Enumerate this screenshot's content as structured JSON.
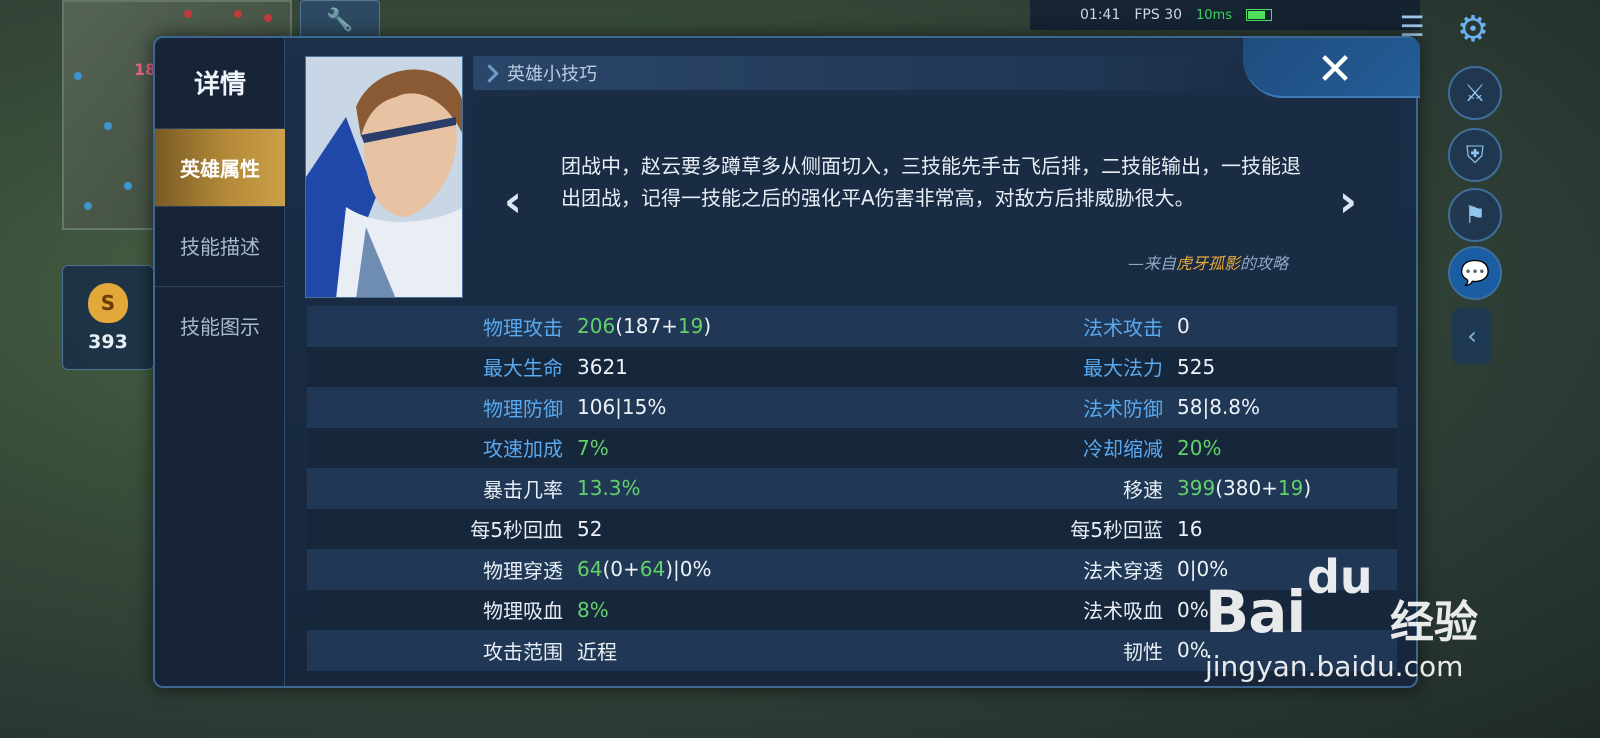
{
  "hud": {
    "minimap_level": "18",
    "gold_value": "393",
    "gold_symbol": "S",
    "timer": "01:41",
    "fps": "FPS 30",
    "net": "10ms"
  },
  "dialog": {
    "title": "详情",
    "tabs": [
      {
        "label": "英雄属性",
        "active": true
      },
      {
        "label": "技能描述",
        "active": false
      },
      {
        "label": "技能图示",
        "active": false
      }
    ],
    "close_glyph": "✕",
    "tips": {
      "header": "英雄小技巧",
      "text": "团战中，赵云要多蹲草多从侧面切入，三技能先手击飞后排，二技能输出，一技能退出团战，记得一技能之后的强化平A伤害非常高，对敌方后排威胁很大。",
      "source_prefix": "—来自",
      "source_author": "虎牙孤影",
      "source_suffix": "的攻略",
      "prev_glyph": "‹",
      "next_glyph": "›"
    },
    "stats": [
      {
        "l1": "物理攻击",
        "l1_color": "blue",
        "v1": [
          {
            "t": "206",
            "c": "green"
          },
          {
            "t": "(187+",
            "c": "white"
          },
          {
            "t": "19",
            "c": "green"
          },
          {
            "t": ")",
            "c": "white"
          }
        ],
        "l2": "法术攻击",
        "l2_color": "blue",
        "v2": [
          {
            "t": "0",
            "c": "white"
          }
        ]
      },
      {
        "l1": "最大生命",
        "l1_color": "blue",
        "v1": [
          {
            "t": "3621",
            "c": "white"
          }
        ],
        "l2": "最大法力",
        "l2_color": "blue",
        "v2": [
          {
            "t": "525",
            "c": "white"
          }
        ]
      },
      {
        "l1": "物理防御",
        "l1_color": "blue",
        "v1": [
          {
            "t": "106|15%",
            "c": "white"
          }
        ],
        "l2": "法术防御",
        "l2_color": "blue",
        "v2": [
          {
            "t": "58|8.8%",
            "c": "white"
          }
        ]
      },
      {
        "l1": "攻速加成",
        "l1_color": "blue",
        "v1": [
          {
            "t": "7%",
            "c": "green"
          }
        ],
        "l2": "冷却缩减",
        "l2_color": "blue",
        "v2": [
          {
            "t": "20%",
            "c": "green"
          }
        ]
      },
      {
        "l1": "暴击几率",
        "l1_color": "white",
        "v1": [
          {
            "t": "13.3%",
            "c": "green"
          }
        ],
        "l2": "移速",
        "l2_color": "white",
        "v2": [
          {
            "t": "399",
            "c": "green"
          },
          {
            "t": "(380+",
            "c": "white"
          },
          {
            "t": "19",
            "c": "green"
          },
          {
            "t": ")",
            "c": "white"
          }
        ]
      },
      {
        "l1": "每5秒回血",
        "l1_color": "white",
        "v1": [
          {
            "t": "52",
            "c": "white"
          }
        ],
        "l2": "每5秒回蓝",
        "l2_color": "white",
        "v2": [
          {
            "t": "16",
            "c": "white"
          }
        ]
      },
      {
        "l1": "物理穿透",
        "l1_color": "white",
        "v1": [
          {
            "t": "64",
            "c": "green"
          },
          {
            "t": "(0+",
            "c": "white"
          },
          {
            "t": "64",
            "c": "green"
          },
          {
            "t": ")|0%",
            "c": "white"
          }
        ],
        "l2": "法术穿透",
        "l2_color": "white",
        "v2": [
          {
            "t": "0|0%",
            "c": "white"
          }
        ]
      },
      {
        "l1": "物理吸血",
        "l1_color": "white",
        "v1": [
          {
            "t": "8%",
            "c": "green"
          }
        ],
        "l2": "法术吸血",
        "l2_color": "white",
        "v2": [
          {
            "t": "0%",
            "c": "white"
          }
        ]
      },
      {
        "l1": "攻击范围",
        "l1_color": "white",
        "v1": [
          {
            "t": "近程",
            "c": "white"
          }
        ],
        "l2": "韧性",
        "l2_color": "white",
        "v2": [
          {
            "t": "0%",
            "c": "white"
          }
        ]
      }
    ]
  },
  "watermark": {
    "brand": "Bai",
    "paw": "du",
    "jingyan": "经验",
    "url": "jingyan.baidu.com"
  },
  "colors": {
    "label_blue": "#5aa8ee",
    "value_green": "#63d16a",
    "active_tab_gold": "#b48a38"
  },
  "icons": [
    "settings-icon",
    "menu-icon",
    "sword-icon",
    "shield-icon",
    "flag-icon",
    "chat-icon",
    "collapse-icon",
    "gold-bag-icon",
    "wrench-icon"
  ]
}
